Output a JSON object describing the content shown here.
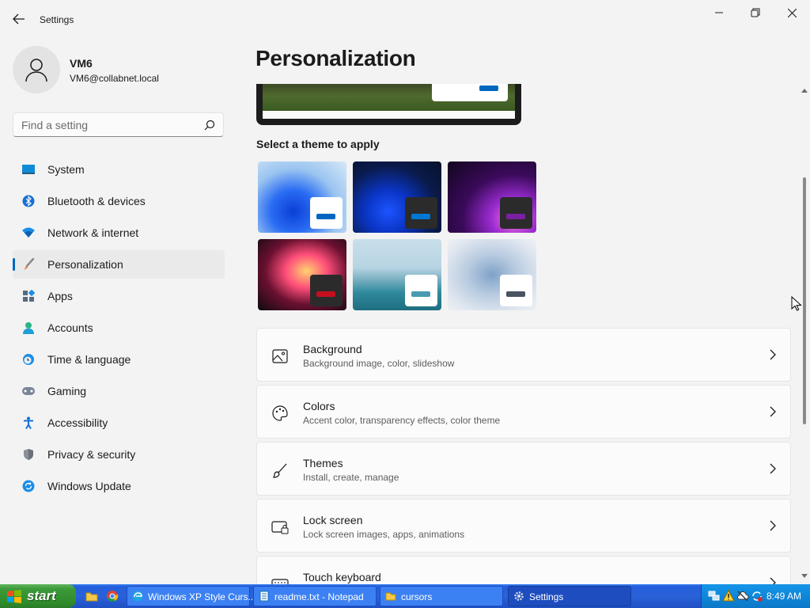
{
  "window": {
    "title": "Settings"
  },
  "user": {
    "name": "VM6",
    "email": "VM6@collabnet.local"
  },
  "search": {
    "placeholder": "Find a setting"
  },
  "nav": {
    "items": [
      {
        "label": "System",
        "icon": "monitor-icon"
      },
      {
        "label": "Bluetooth & devices",
        "icon": "bluetooth-icon"
      },
      {
        "label": "Network & internet",
        "icon": "wifi-icon"
      },
      {
        "label": "Personalization",
        "icon": "brush-icon",
        "active": true
      },
      {
        "label": "Apps",
        "icon": "apps-icon"
      },
      {
        "label": "Accounts",
        "icon": "accounts-icon"
      },
      {
        "label": "Time & language",
        "icon": "clock-globe-icon"
      },
      {
        "label": "Gaming",
        "icon": "gamepad-icon"
      },
      {
        "label": "Accessibility",
        "icon": "accessibility-icon"
      },
      {
        "label": "Privacy & security",
        "icon": "shield-icon"
      },
      {
        "label": "Windows Update",
        "icon": "update-icon"
      }
    ]
  },
  "main": {
    "page_title": "Personalization",
    "theme_section_label": "Select a theme to apply",
    "themes": [
      {
        "name": "windows-light",
        "accent": "#0067c0"
      },
      {
        "name": "windows-dark",
        "accent": "#0078d4"
      },
      {
        "name": "glow",
        "accent": "#7a1fa2"
      },
      {
        "name": "captured-motion",
        "accent": "#c50f1f"
      },
      {
        "name": "sunrise",
        "accent": "#4a9bb0"
      },
      {
        "name": "flow",
        "accent": "#4a5460"
      }
    ],
    "cards": [
      {
        "title": "Background",
        "subtitle": "Background image, color, slideshow",
        "icon": "picture-icon"
      },
      {
        "title": "Colors",
        "subtitle": "Accent color, transparency effects, color theme",
        "icon": "palette-icon"
      },
      {
        "title": "Themes",
        "subtitle": "Install, create, manage",
        "icon": "brush-icon"
      },
      {
        "title": "Lock screen",
        "subtitle": "Lock screen images, apps, animations",
        "icon": "lock-screen-icon"
      },
      {
        "title": "Touch keyboard",
        "subtitle": "",
        "icon": "keyboard-icon"
      }
    ]
  },
  "taskbar": {
    "start_label": "start",
    "buttons": [
      {
        "label": "Windows XP Style Curs...",
        "icon": "edge-icon"
      },
      {
        "label": "readme.txt - Notepad",
        "icon": "notepad-icon"
      },
      {
        "label": "cursors",
        "icon": "folder-icon"
      },
      {
        "label": "Settings",
        "icon": "gear-icon",
        "active": true
      }
    ],
    "clock": "8:49 AM"
  },
  "colors": {
    "accent": "#0067c0",
    "taskbar": "#245edb",
    "start": "#3c9a3a"
  }
}
